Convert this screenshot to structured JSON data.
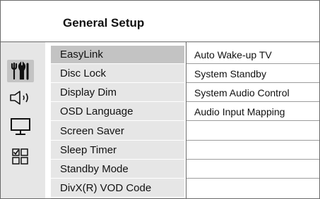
{
  "header": {
    "title": "General Setup"
  },
  "icons": [
    {
      "name": "general-setup-icon",
      "selected": true
    },
    {
      "name": "audio-setup-icon",
      "selected": false
    },
    {
      "name": "video-setup-icon",
      "selected": false
    },
    {
      "name": "preference-setup-icon",
      "selected": false
    }
  ],
  "menu": {
    "selected_index": 0,
    "items": [
      {
        "label": "EasyLink"
      },
      {
        "label": "Disc Lock"
      },
      {
        "label": "Display Dim"
      },
      {
        "label": "OSD Language"
      },
      {
        "label": "Screen Saver"
      },
      {
        "label": "Sleep Timer"
      },
      {
        "label": "Standby Mode"
      },
      {
        "label": "DivX(R) VOD Code"
      }
    ]
  },
  "submenu": {
    "items": [
      {
        "label": "Auto Wake-up TV"
      },
      {
        "label": "System Standby"
      },
      {
        "label": "System Audio Control"
      },
      {
        "label": "Audio Input Mapping"
      },
      {
        "label": ""
      },
      {
        "label": ""
      },
      {
        "label": ""
      },
      {
        "label": ""
      }
    ]
  },
  "colors": {
    "panel_bg": "#e6e6e6",
    "selected_bg": "#c3c3c3",
    "border": "#6a6a6a"
  }
}
